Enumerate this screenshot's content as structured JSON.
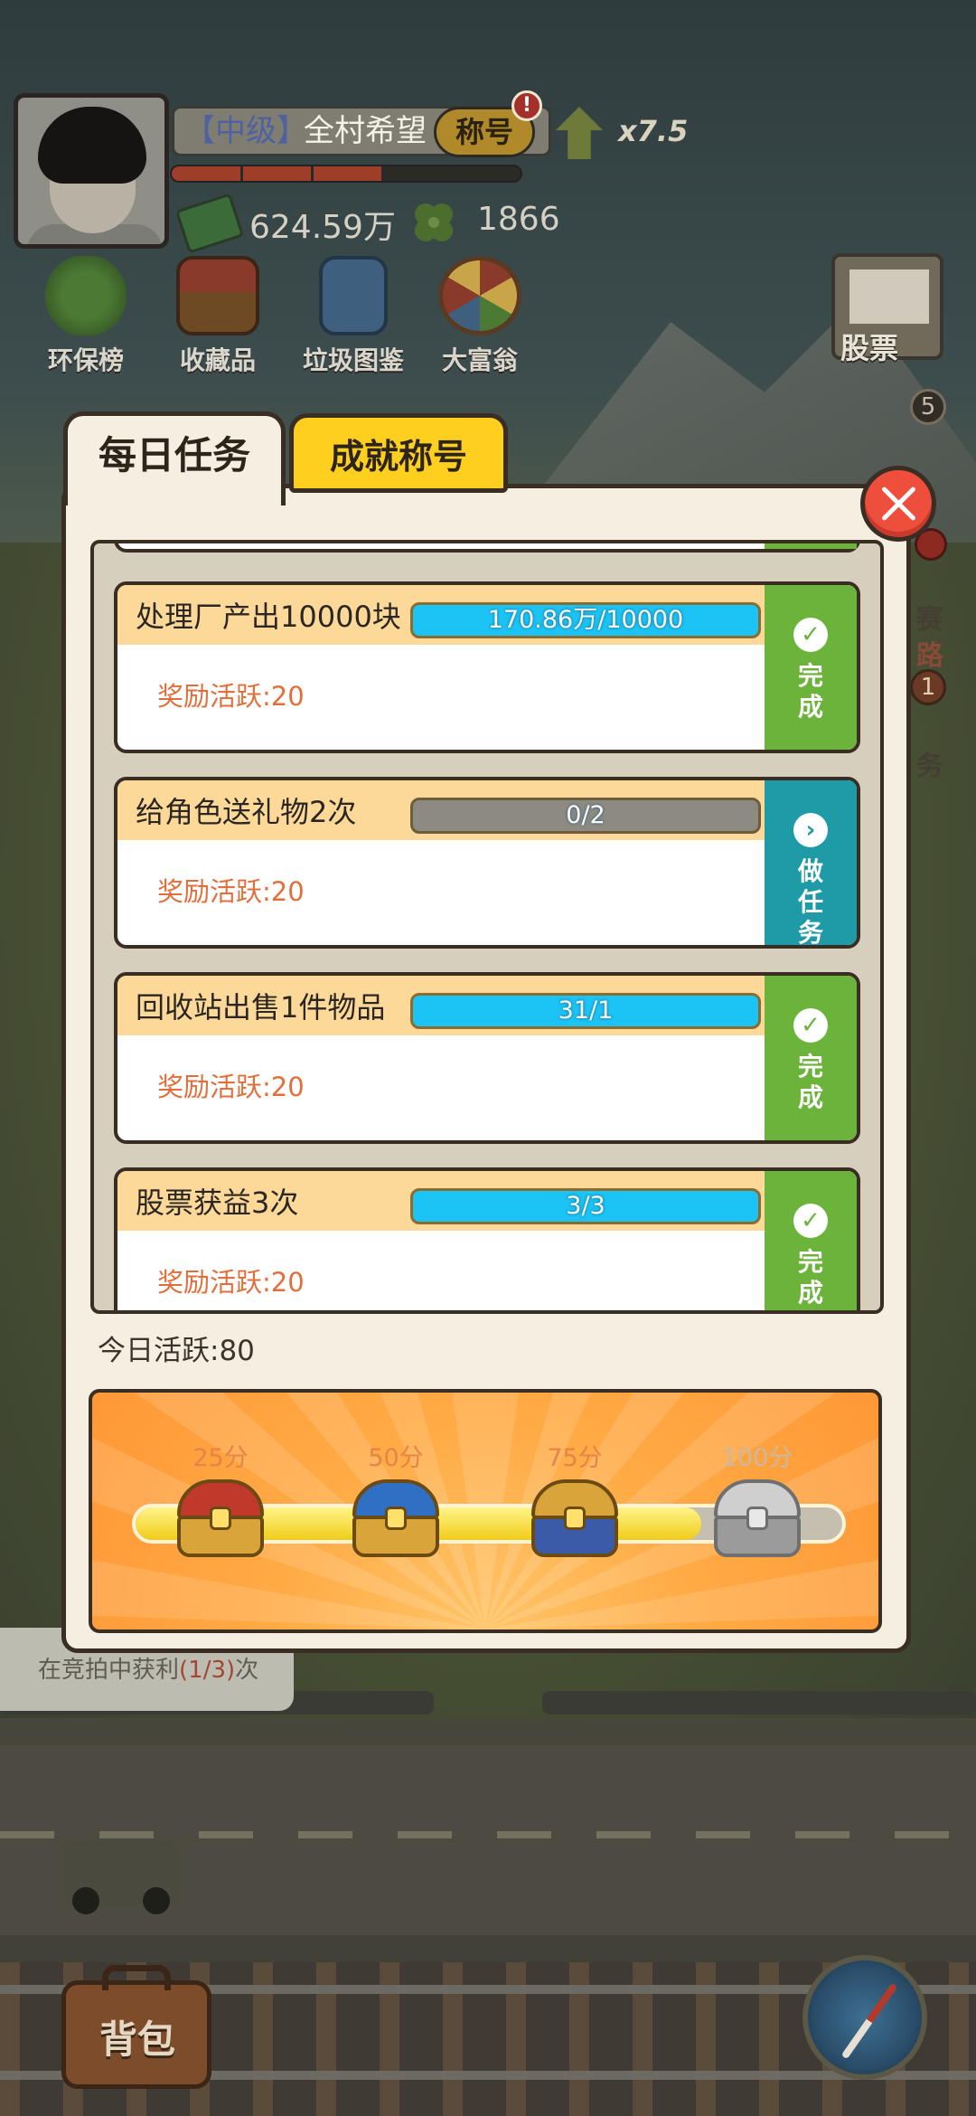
{
  "hud": {
    "rank": "【中级】",
    "player_title": "全村希望",
    "title_button": "称号",
    "title_badge": "!",
    "xp_progress": 0.6,
    "multiplier": "x7.5",
    "cash": "624.59万",
    "clovers": "1866"
  },
  "menu": [
    {
      "label": "环保榜",
      "icon": "clover-trophy-icon"
    },
    {
      "label": "收藏品",
      "icon": "treasure-chest-icon"
    },
    {
      "label": "垃圾图鉴",
      "icon": "notebook-icon"
    },
    {
      "label": "大富翁",
      "icon": "roulette-icon"
    },
    {
      "label": "股票",
      "icon": "stock-chart-icon"
    }
  ],
  "side": {
    "badge_top": "5",
    "text_a": "赛",
    "text_b": "路",
    "badge_mid": "1",
    "text_c": "务"
  },
  "dialog": {
    "tabs": [
      {
        "label": "每日任务",
        "active": true
      },
      {
        "label": "成就称号",
        "active": false
      }
    ],
    "tasks": [
      {
        "title": "处理厂产出10000块",
        "progress": "170.86万/10000",
        "percent": 1.0,
        "reward": "奖励活跃:20",
        "status": "done",
        "action": "完成"
      },
      {
        "title": "给角色送礼物2次",
        "progress": "0/2",
        "percent": 0.0,
        "reward": "奖励活跃:20",
        "status": "todo",
        "action": "做任务"
      },
      {
        "title": "回收站出售1件物品",
        "progress": "31/1",
        "percent": 1.0,
        "reward": "奖励活跃:20",
        "status": "done",
        "action": "完成"
      },
      {
        "title": "股票获益3次",
        "progress": "3/3",
        "percent": 1.0,
        "reward": "奖励活跃:20",
        "status": "done",
        "action": "完成"
      }
    ],
    "today_activity": "今日活跃:80",
    "activity_value": 80,
    "milestones": [
      {
        "label": "25分",
        "colors": [
          "#c0392b",
          "#d9a43a"
        ]
      },
      {
        "label": "50分",
        "colors": [
          "#2f6fc4",
          "#d9a43a"
        ]
      },
      {
        "label": "75分",
        "colors": [
          "#d9a43a",
          "#3b5aa8"
        ]
      },
      {
        "label": "100分",
        "colors": [
          "#cfcfcf",
          "#9b9b9b"
        ]
      }
    ]
  },
  "auction_tip": {
    "prefix": "在竞拍中获利",
    "count": "(1/3)",
    "suffix": "次"
  },
  "bag_button": "背包",
  "colors": {
    "accent_yellow": "#ffcf1f",
    "done_green": "#6bb33a",
    "todo_teal": "#1f9ba8",
    "progress_blue": "#1cc3f5",
    "reward_orange": "#e26e3c",
    "close_red": "#ee4e3c"
  }
}
